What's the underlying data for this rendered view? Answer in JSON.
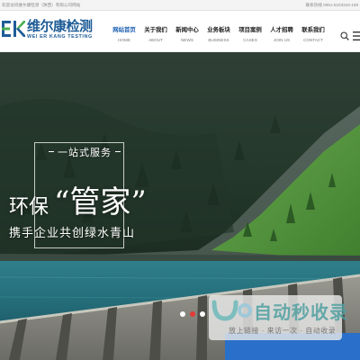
{
  "topbar": {
    "welcome": "欢迎访问维尔康检测（陕西）有限公司网站",
    "contact": "联系热线 0951-5103344-168"
  },
  "logo": {
    "mark_text": "EK",
    "name_cn": "维尔康检测",
    "name_en": "WEI ER KANG TESTING"
  },
  "nav": {
    "items": [
      {
        "cn": "网站首页",
        "en": "HOME",
        "active": true
      },
      {
        "cn": "关于我们",
        "en": "ABOUT",
        "active": false
      },
      {
        "cn": "新闻中心",
        "en": "NEWS",
        "active": false
      },
      {
        "cn": "业务板块",
        "en": "BUSINESS",
        "active": false
      },
      {
        "cn": "项目案例",
        "en": "CASES",
        "active": false
      },
      {
        "cn": "人才招聘",
        "en": "JOIN US",
        "active": false
      },
      {
        "cn": "联系我们",
        "en": "CONTACT",
        "active": false
      }
    ],
    "search_icon": "search-icon",
    "menu_icon": "menu-icon"
  },
  "banner": {
    "slogan_small": "一站式服务",
    "slogan_big1": "环保",
    "slogan_big2": "“管家”",
    "slogan_sub": "携手企业共创绿水青山",
    "active_slide": 1,
    "slide_count": 3
  },
  "watermark": {
    "title": "自动秒收录",
    "subtitle": "放上链接 · 来访一次 · 自动收录"
  },
  "colors": {
    "brand_blue": "#1e5c97",
    "brand_green": "#4caf50",
    "accent_blue": "#2a6fc9",
    "dot_active": "#e53935",
    "dot_inactive": "#ffffff"
  }
}
